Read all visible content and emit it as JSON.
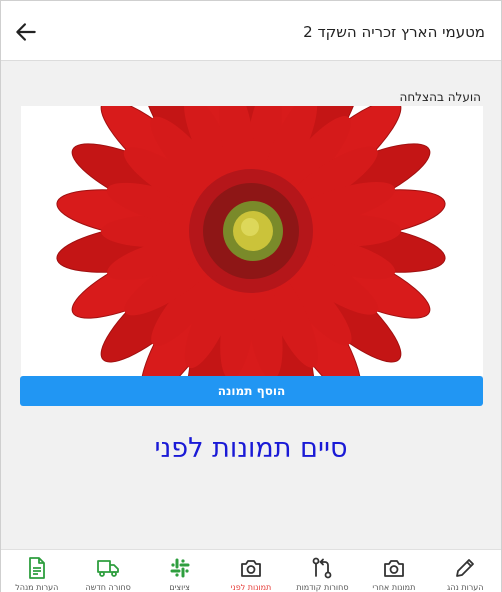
{
  "header": {
    "title": "מטעמי הארץ זכריה השקד 2",
    "back_icon": "arrow-left-icon"
  },
  "status_text": "הועלה בהצלחה",
  "photo": {
    "subject": "red-gerbera-flower",
    "colors": {
      "petal": "#d81b1b",
      "center": "#cbc33a"
    }
  },
  "add_photo_button": "הוסף תמונה",
  "finish_link": "סיים תמונות לפני",
  "colors": {
    "accent": "#2196f3",
    "finish": "#1a1ad6",
    "active_tab": "#e53935",
    "green_icon": "#2e9e3e"
  },
  "bottom_nav": [
    {
      "label": "הערות נהג",
      "icon": "pencil-icon"
    },
    {
      "label": "תמונות אחרי",
      "icon": "camera-icon"
    },
    {
      "label": "סחורות קודמות",
      "icon": "git-compare-icon"
    },
    {
      "label": "תמונות לפני",
      "icon": "camera-icon",
      "active": true
    },
    {
      "label": "ציוצים",
      "icon": "slack-icon"
    },
    {
      "label": "סחורה חדשה",
      "icon": "truck-icon"
    },
    {
      "label": "הערות מנהל",
      "icon": "document-icon"
    }
  ]
}
